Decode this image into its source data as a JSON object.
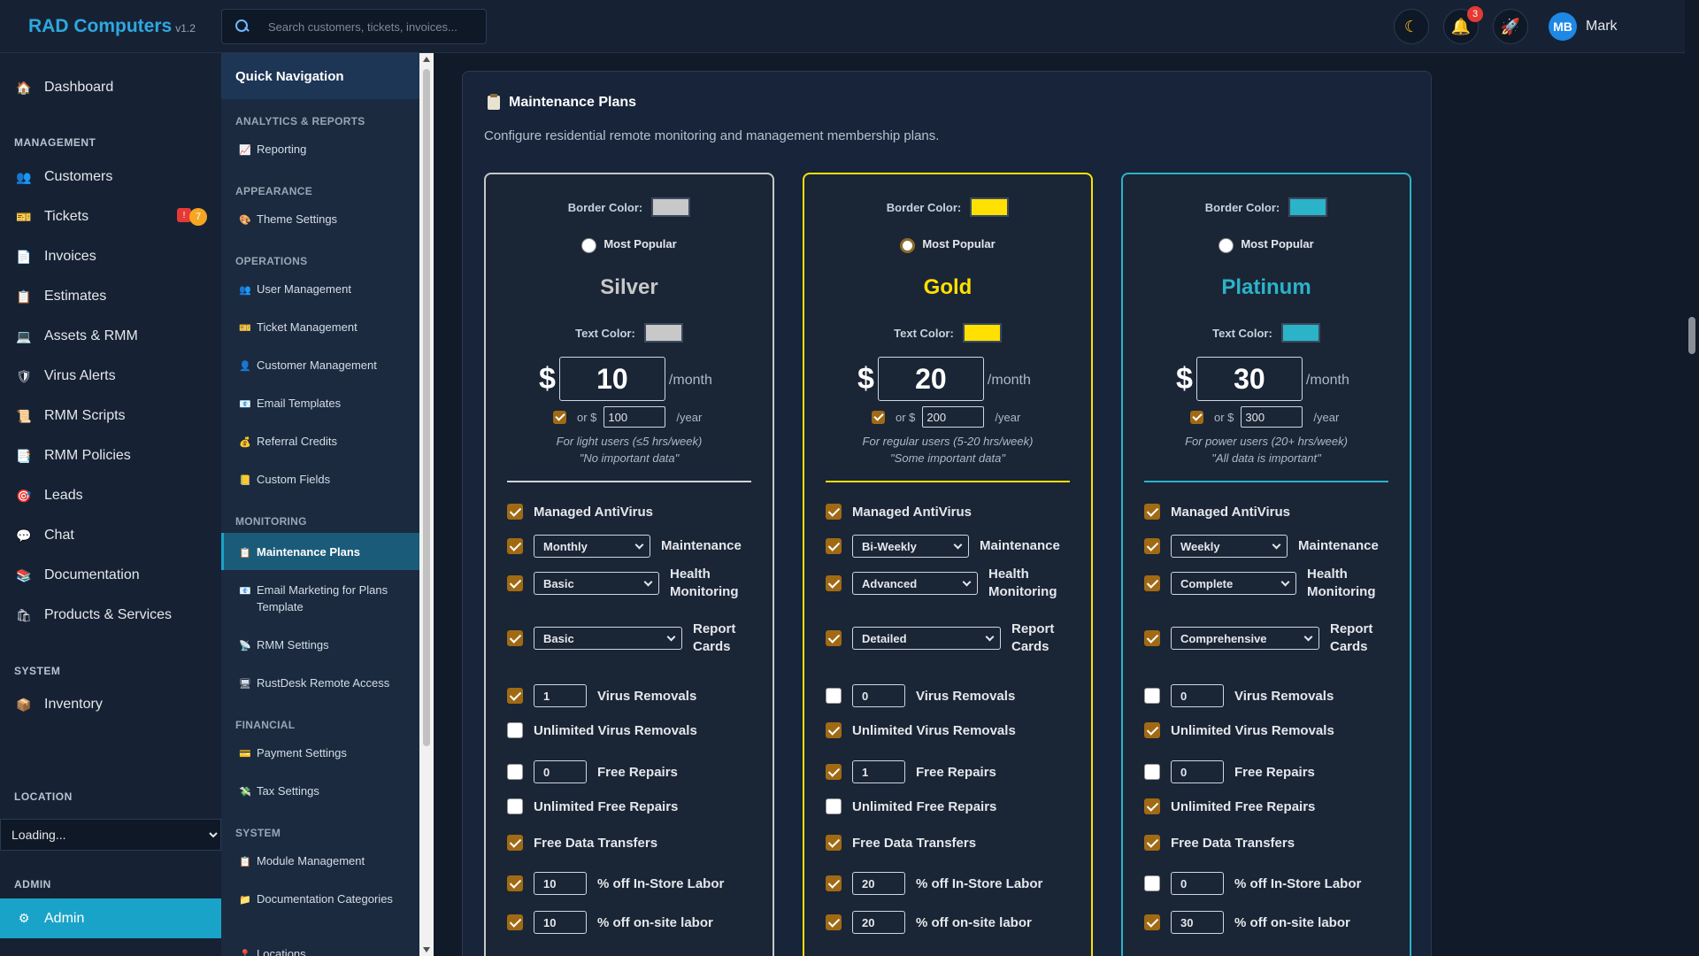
{
  "app": {
    "brand": "RAD Computers",
    "version": "v1.2"
  },
  "search": {
    "placeholder": "Search customers, tickets, invoices..."
  },
  "topbar": {
    "notifications_count": "3",
    "user_initials": "MB",
    "user_name": "Mark"
  },
  "sidebar": {
    "dashboard": "Dashboard",
    "management_title": "MANAGEMENT",
    "customers": "Customers",
    "tickets": "Tickets",
    "tickets_badge_alert": "!",
    "tickets_badge_count": "7",
    "invoices": "Invoices",
    "estimates": "Estimates",
    "assets": "Assets & RMM",
    "virus_alerts": "Virus Alerts",
    "rmm_scripts": "RMM Scripts",
    "rmm_policies": "RMM Policies",
    "leads": "Leads",
    "chat": "Chat",
    "documentation": "Documentation",
    "products": "Products & Services",
    "system_title": "SYSTEM",
    "inventory": "Inventory",
    "location_title": "LOCATION",
    "location_value": "Loading...",
    "admin_title": "ADMIN",
    "admin": "Admin"
  },
  "quicknav": {
    "title": "Quick Navigation",
    "analytics_title": "ANALYTICS & REPORTS",
    "reporting": "Reporting",
    "appearance_title": "APPEARANCE",
    "theme_settings": "Theme Settings",
    "operations_title": "OPERATIONS",
    "user_management": "User Management",
    "ticket_management": "Ticket Management",
    "customer_management": "Customer Management",
    "email_templates": "Email Templates",
    "referral_credits": "Referral Credits",
    "custom_fields": "Custom Fields",
    "monitoring_title": "MONITORING",
    "maintenance_plans": "Maintenance Plans",
    "email_marketing": "Email Marketing for Plans Template",
    "rmm_settings": "RMM Settings",
    "rustdesk": "RustDesk Remote Access",
    "financial_title": "FINANCIAL",
    "payment_settings": "Payment Settings",
    "tax_settings": "Tax Settings",
    "system_title": "SYSTEM",
    "module_management": "Module Management",
    "doc_categories": "Documentation Categories",
    "locations": "Locations"
  },
  "main": {
    "title": "Maintenance Plans",
    "subtitle": "Configure residential remote monitoring and management membership plans."
  },
  "labels": {
    "border_color": "Border Color:",
    "most_popular": "Most Popular",
    "text_color": "Text Color:",
    "dollar": "$",
    "per_month": "/month",
    "or_dollar": "or $",
    "per_year": "/year",
    "managed_antivirus": "Managed AntiVirus",
    "maintenance": "Maintenance",
    "health_monitoring": "Health Monitoring",
    "report_cards": "Report Cards",
    "virus_removals": "Virus Removals",
    "unlimited_virus_removals": "Unlimited Virus Removals",
    "free_repairs": "Free Repairs",
    "unlimited_free_repairs": "Unlimited Free Repairs",
    "free_data_transfers": "Free Data Transfers",
    "instore_labor": "% off In-Store Labor",
    "onsite_labor": "% off on-site labor"
  },
  "plans": [
    {
      "name": "Silver",
      "border_color": "#c8c8c8",
      "text_color": "#c8c8c8",
      "most_popular": false,
      "monthly": "10",
      "yearly_enabled": true,
      "yearly": "100",
      "desc1": "For light users (≤5 hrs/week)",
      "desc2": "\"No important data\"",
      "antivirus": true,
      "maintenance_on": true,
      "maintenance": "Monthly",
      "health_on": true,
      "health": "Basic",
      "report_on": true,
      "report": "Basic",
      "virus_on": true,
      "virus": "1",
      "unl_virus": false,
      "repairs_on": false,
      "repairs": "0",
      "unl_repairs": false,
      "data_transfers": true,
      "instore_on": true,
      "instore": "10",
      "onsite_on": true,
      "onsite": "10"
    },
    {
      "name": "Gold",
      "border_color": "#ffe000",
      "text_color": "#ffe000",
      "most_popular": true,
      "monthly": "20",
      "yearly_enabled": true,
      "yearly": "200",
      "desc1": "For regular users (5-20 hrs/week)",
      "desc2": "\"Some important data\"",
      "antivirus": true,
      "maintenance_on": true,
      "maintenance": "Bi-Weekly",
      "health_on": true,
      "health": "Advanced",
      "report_on": true,
      "report": "Detailed",
      "virus_on": false,
      "virus": "0",
      "unl_virus": true,
      "repairs_on": true,
      "repairs": "1",
      "unl_repairs": false,
      "data_transfers": true,
      "instore_on": true,
      "instore": "20",
      "onsite_on": true,
      "onsite": "20"
    },
    {
      "name": "Platinum",
      "border_color": "#2bb3c8",
      "text_color": "#2bb3c8",
      "most_popular": false,
      "monthly": "30",
      "yearly_enabled": true,
      "yearly": "300",
      "desc1": "For power users (20+ hrs/week)",
      "desc2": "\"All data is important\"",
      "antivirus": true,
      "maintenance_on": true,
      "maintenance": "Weekly",
      "health_on": true,
      "health": "Complete",
      "report_on": true,
      "report": "Comprehensive",
      "virus_on": false,
      "virus": "0",
      "unl_virus": true,
      "repairs_on": false,
      "repairs": "0",
      "unl_repairs": true,
      "data_transfers": true,
      "instore_on": false,
      "instore": "0",
      "onsite_on": true,
      "onsite": "30"
    }
  ]
}
